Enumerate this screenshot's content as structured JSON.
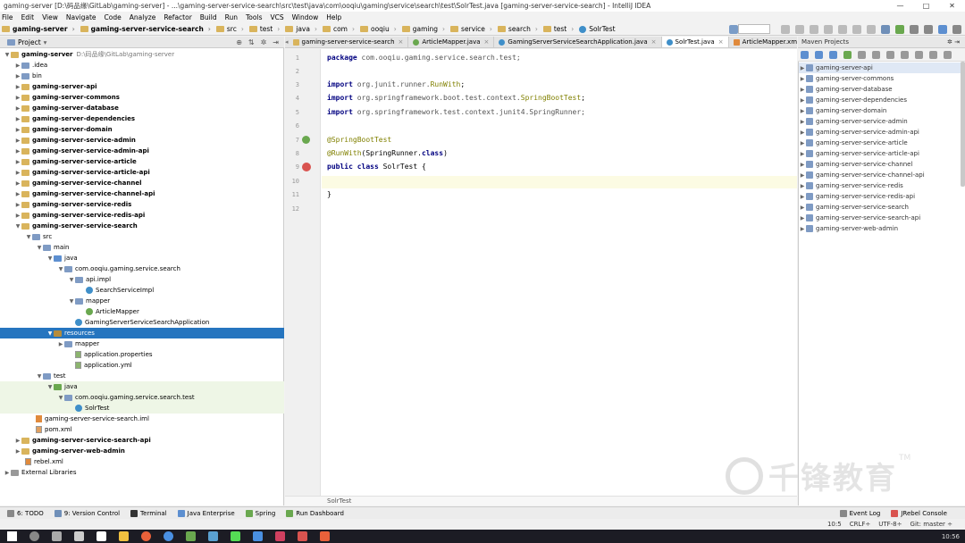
{
  "titlebar": {
    "text": "gaming-server [D:\\码品缘\\GitLab\\gaming-server] - ...\\gaming-server-service-search\\src\\test\\java\\com\\ooqiu\\gaming\\service\\search\\test\\SolrTest.java [gaming-server-service-search] - IntelliJ IDEA",
    "minimize": "—",
    "maximize": "□",
    "close": "✕"
  },
  "menu": [
    "File",
    "Edit",
    "View",
    "Navigate",
    "Code",
    "Analyze",
    "Refactor",
    "Build",
    "Run",
    "Tools",
    "VCS",
    "Window",
    "Help"
  ],
  "breadcrumbs": [
    "gaming-server",
    "gaming-server-service-search",
    "src",
    "test",
    "java",
    "com",
    "ooqiu",
    "gaming",
    "service",
    "search",
    "test",
    "SolrTest"
  ],
  "project_panel": {
    "title": "Project",
    "root_label": "gaming-server",
    "root_path": "D:\\码品缘\\GitLab\\gaming-server",
    "items": [
      {
        "label": ".idea"
      },
      {
        "label": "bin"
      },
      {
        "label": "gaming-server-api"
      },
      {
        "label": "gaming-server-commons"
      },
      {
        "label": "gaming-server-database"
      },
      {
        "label": "gaming-server-dependencies"
      },
      {
        "label": "gaming-server-domain"
      },
      {
        "label": "gaming-server-service-admin"
      },
      {
        "label": "gaming-server-service-admin-api"
      },
      {
        "label": "gaming-server-service-article"
      },
      {
        "label": "gaming-server-service-article-api"
      },
      {
        "label": "gaming-server-service-channel"
      },
      {
        "label": "gaming-server-service-channel-api"
      },
      {
        "label": "gaming-server-service-redis"
      },
      {
        "label": "gaming-server-service-redis-api"
      },
      {
        "label": "gaming-server-service-search"
      },
      {
        "label": "src"
      },
      {
        "label": "main"
      },
      {
        "label": "java"
      },
      {
        "label": "com.ooqiu.gaming.service.search"
      },
      {
        "label": "api.impl"
      },
      {
        "label": "SearchServiceImpl"
      },
      {
        "label": "mapper"
      },
      {
        "label": "ArticleMapper"
      },
      {
        "label": "GamingServerServiceSearchApplication"
      },
      {
        "label": "resources"
      },
      {
        "label": "mapper"
      },
      {
        "label": "application.properties"
      },
      {
        "label": "application.yml"
      },
      {
        "label": "test"
      },
      {
        "label": "java"
      },
      {
        "label": "com.ooqiu.gaming.service.search.test"
      },
      {
        "label": "SolrTest"
      },
      {
        "label": "gaming-server-service-search.iml"
      },
      {
        "label": "pom.xml"
      },
      {
        "label": "gaming-server-service-search-api"
      },
      {
        "label": "gaming-server-web-admin"
      },
      {
        "label": "rebel.xml"
      },
      {
        "label": "External Libraries"
      }
    ]
  },
  "editor_tabs": [
    {
      "label": "gaming-server-service-search"
    },
    {
      "label": "ArticleMapper.java"
    },
    {
      "label": "GamingServerServiceSearchApplication.java"
    },
    {
      "label": "SolrTest.java"
    },
    {
      "label": "ArticleMapper.xml"
    }
  ],
  "editor": {
    "line_numbers": [
      "1",
      "2",
      "3",
      "4",
      "5",
      "6",
      "7",
      "8",
      "9",
      "10",
      "11",
      "12"
    ],
    "line1_kw": "package",
    "line1_rest": " com.ooqiu.gaming.service.search.test;",
    "line3_kw": "import",
    "line3_pkg": " org.junit.runner.",
    "line3_cls": "RunWith",
    "line3_end": ";",
    "line4_kw": "import",
    "line4_pkg": " org.springframework.boot.test.context.",
    "line4_cls": "SpringBootTest",
    "line4_end": ";",
    "line5_kw": "import",
    "line5_rest": " org.springframework.test.context.junit4.SpringRunner;",
    "line7": "@SpringBootTest",
    "line8_ann": "@RunWith",
    "line8_rest": "(SpringRunner.",
    "line8_cls": "class",
    "line8_end": ")",
    "line9_kw": "public class",
    "line9_rest": " SolrTest {",
    "line11": "}",
    "status_text": "SolrTest"
  },
  "maven_panel": {
    "title": "Maven Projects",
    "items": [
      "gaming-server-api",
      "gaming-server-commons",
      "gaming-server-database",
      "gaming-server-dependencies",
      "gaming-server-domain",
      "gaming-server-service-admin",
      "gaming-server-service-admin-api",
      "gaming-server-service-article",
      "gaming-server-service-article-api",
      "gaming-server-service-channel",
      "gaming-server-service-channel-api",
      "gaming-server-service-redis",
      "gaming-server-service-redis-api",
      "gaming-server-service-search",
      "gaming-server-service-search-api",
      "gaming-server-web-admin"
    ]
  },
  "tool_windows": [
    "6: TODO",
    "9: Version Control",
    "Terminal",
    "Java Enterprise",
    "Spring",
    "Run Dashboard"
  ],
  "tool_windows_right": [
    "Event Log",
    "JRebel Console"
  ],
  "statusbar": [
    "10:5",
    "CRLF÷",
    "UTF-8÷",
    "Git: master ÷"
  ],
  "taskbar": {
    "time": "10:56"
  },
  "watermark": {
    "text": "千锋教育",
    "tm": "TM"
  },
  "colors": {
    "selection": "#2675bf",
    "keyword": "#000080",
    "annotation": "#808000"
  }
}
